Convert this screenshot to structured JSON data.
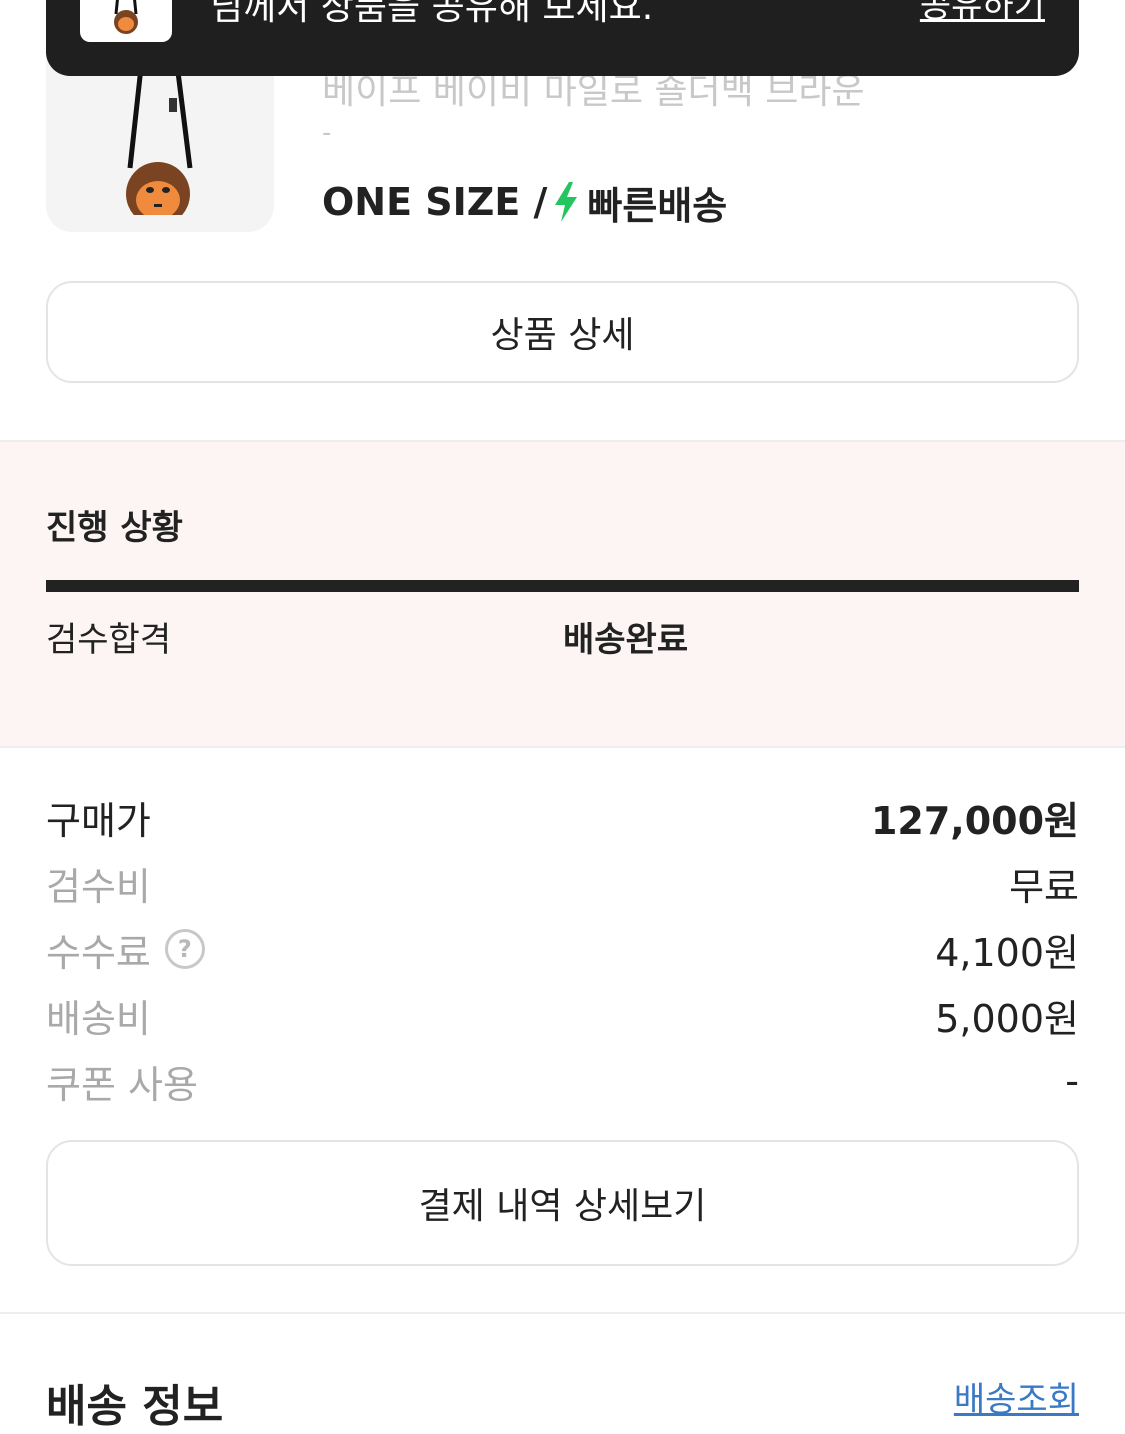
{
  "toast": {
    "message": "님께서 상품을 공유해 보세요.",
    "action_label": "공유하기"
  },
  "product": {
    "name": "베이프 베이비 마일로 숄더백 브라운",
    "sub": "-",
    "size": "ONE SIZE /",
    "delivery_badge": "빠른배송",
    "detail_button": "상품 상세"
  },
  "progress": {
    "title": "진행 상황",
    "fill_fraction": 1.0,
    "steps": [
      "검수합격",
      "배송완료"
    ]
  },
  "price": {
    "rows": [
      {
        "label": "구매가",
        "value": "127,000원"
      },
      {
        "label": "검수비",
        "value": "무료"
      },
      {
        "label": "수수료",
        "value": "4,100원"
      },
      {
        "label": "배송비",
        "value": "5,000원"
      },
      {
        "label": "쿠폰 사용",
        "value": "-"
      }
    ],
    "detail_button": "결제 내역 상세보기"
  },
  "delivery": {
    "title": "배송 정보",
    "link": "배송조회"
  },
  "colors": {
    "progress_bg": "#fcf5f4",
    "bolt": "#22c55e",
    "link": "#3a79c4",
    "toast_bg": "#1f1f1f"
  },
  "icons": {
    "bolt": "lightning-bolt-icon",
    "help": "question-circle-icon"
  }
}
